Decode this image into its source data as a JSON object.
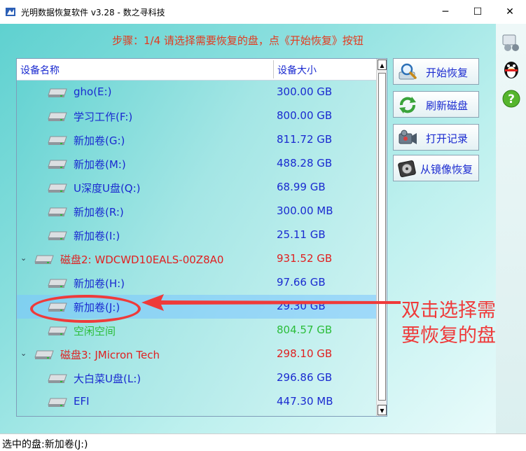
{
  "window": {
    "title": "光明数据恢复软件 v3.28 - 数之寻科技",
    "minimize_glyph": "─",
    "maximize_glyph": "☐",
    "close_glyph": "✕"
  },
  "step_hint": "步骤：1/4 请选择需要恢复的盘，点《开始恢复》按钮",
  "device_list": {
    "columns": {
      "name": "设备名称",
      "size": "设备大小"
    },
    "rows": [
      {
        "name": "gho(E:)",
        "size": "300.00 GB",
        "kind": "volume"
      },
      {
        "name": "学习工作(F:)",
        "size": "800.00 GB",
        "kind": "volume"
      },
      {
        "name": "新加卷(G:)",
        "size": "811.72 GB",
        "kind": "volume"
      },
      {
        "name": "新加卷(M:)",
        "size": "488.28 GB",
        "kind": "volume"
      },
      {
        "name": "U深度U盘(Q:)",
        "size": "68.99 GB",
        "kind": "volume"
      },
      {
        "name": "新加卷(R:)",
        "size": "300.00 MB",
        "kind": "volume"
      },
      {
        "name": "新加卷(I:)",
        "size": "25.11 GB",
        "kind": "volume"
      },
      {
        "name": "磁盘2: WDCWD10EALS-00Z8A0",
        "size": "931.52 GB",
        "kind": "disk"
      },
      {
        "name": "新加卷(H:)",
        "size": "97.66 GB",
        "kind": "volume"
      },
      {
        "name": "新加卷(J:)",
        "size": "29.30 GB",
        "kind": "volume",
        "selected": true
      },
      {
        "name": "空闲空间",
        "size": "804.57 GB",
        "kind": "free"
      },
      {
        "name": "磁盘3: JMicron  Tech",
        "size": "298.10 GB",
        "kind": "disk"
      },
      {
        "name": "大白菜U盘(L:)",
        "size": "296.86 GB",
        "kind": "volume"
      },
      {
        "name": "EFI",
        "size": "447.30 MB",
        "kind": "volume"
      }
    ]
  },
  "actions": {
    "start_recovery": "开始恢复",
    "refresh_disks": "刷新磁盘",
    "open_record": "打开记录",
    "restore_from_image": "从镜像恢复"
  },
  "status": "选中的盘:新加卷(J:)",
  "annotation": {
    "line1": "双击选择需",
    "line2": "要恢复的盘"
  },
  "colors": {
    "hint_red": "#e33a1e",
    "text_blue": "#1a2ad0",
    "disk_red": "#e02020",
    "free_green": "#2bbd3a",
    "annotation_red": "#ef3a3a"
  },
  "icons": {
    "app": "app-icon",
    "drive": "hard-drive-icon",
    "expander": "chevron-down-icon",
    "start": "magnifier-icon",
    "refresh": "refresh-arrows-icon",
    "record": "camera-icon",
    "image": "disk-image-icon",
    "side": [
      "user-group-icon",
      "penguin-icon",
      "help-icon"
    ]
  }
}
